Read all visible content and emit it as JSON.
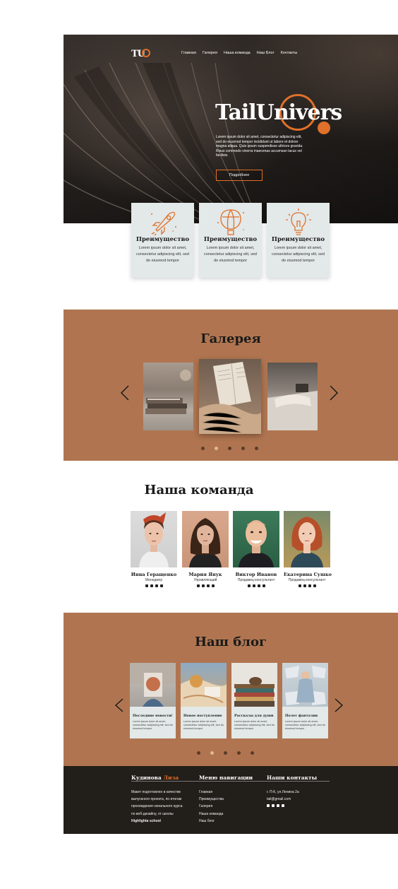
{
  "brand": {
    "logo": "TU",
    "accent": "#e0702a",
    "panel": "#b07550",
    "dark": "#221e1a"
  },
  "nav": [
    "Главная",
    "Галерея",
    "Наша команда",
    "Наш Блог",
    "Контакты"
  ],
  "hero": {
    "title": "TailUnivers",
    "description": "Lorem ipsum dolor sit amet, consectetur adipiscing elit, sed do eiusmod tempor incididunt ut labore et dolore magna aliqua. Quis ipsum suspendisse ultrices gravida. Risus commodo viverra maecenas accumsan lacus vel facilisis.",
    "button": "Подробнее"
  },
  "features": [
    {
      "icon": "rocket-icon",
      "title": "Преимущество",
      "text": "Lorem ipsum dolor sit amet, consectetur adipiscing elit, sed do eiusmod tempor"
    },
    {
      "icon": "balloon-icon",
      "title": "Преимущество",
      "text": "Lorem ipsum dolor sit amet, consectetur adipiscing elit, sed do eiusmod tempor"
    },
    {
      "icon": "lightbulb-icon",
      "title": "Преимущество",
      "text": "Lorem ipsum dolor sit amet, consectetur adipiscing elit, sed do eiusmod tempor"
    }
  ],
  "gallery": {
    "title": "Галерея",
    "prev": "‹",
    "next": "›",
    "active_dot": 1,
    "dot_count": 5
  },
  "team": {
    "title": "Наша команда",
    "members": [
      {
        "name": "Инна Геращенко",
        "role": "Менеджер"
      },
      {
        "name": "Мария Янук",
        "role": "Управляющий"
      },
      {
        "name": "Виктор Иванов",
        "role": "Продавец-консультант"
      },
      {
        "name": "Екатерина Сушко",
        "role": "Продавец-консультант"
      }
    ]
  },
  "blog": {
    "title": "Наш блог",
    "prev": "‹",
    "next": "›",
    "active_dot": 1,
    "dot_count": 5,
    "posts": [
      {
        "title": "Последние новости!",
        "text": "Lorem ipsum dolor sit amet, consectetur adipiscing elit, sed do eiusmod tempor"
      },
      {
        "title": "Новое поступление",
        "text": "Lorem ipsum dolor sit amet, consectetur adipiscing elit, sed do eiusmod tempor"
      },
      {
        "title": "Рассказы для души",
        "text": "Lorem ipsum dolor sit amet, consectetur adipiscing elit, sed do eiusmod tempor"
      },
      {
        "title": "Полет фантазии",
        "text": "Lorem ipsum dolor sit amet, consectetur adipiscing elit, sed do eiusmod tempor"
      }
    ]
  },
  "footer": {
    "author_first": "Кудинова",
    "author_last": "Лиза",
    "about_lines": [
      "Макет подготовлен в качестве",
      "выпускного проекта, по итогам",
      "прохождения начального курса",
      "по веб-дизайну, от школы"
    ],
    "school": "Highlighta school",
    "nav_title": "Меню навигации",
    "nav_links": [
      "Главная",
      "Преимущества",
      "Галерея",
      "Наша команда",
      "Наш блог"
    ],
    "contacts_title": "Наши контакты",
    "address": "г. П-К, ул.Ленина 2а",
    "email": "tail@gmail.com"
  }
}
